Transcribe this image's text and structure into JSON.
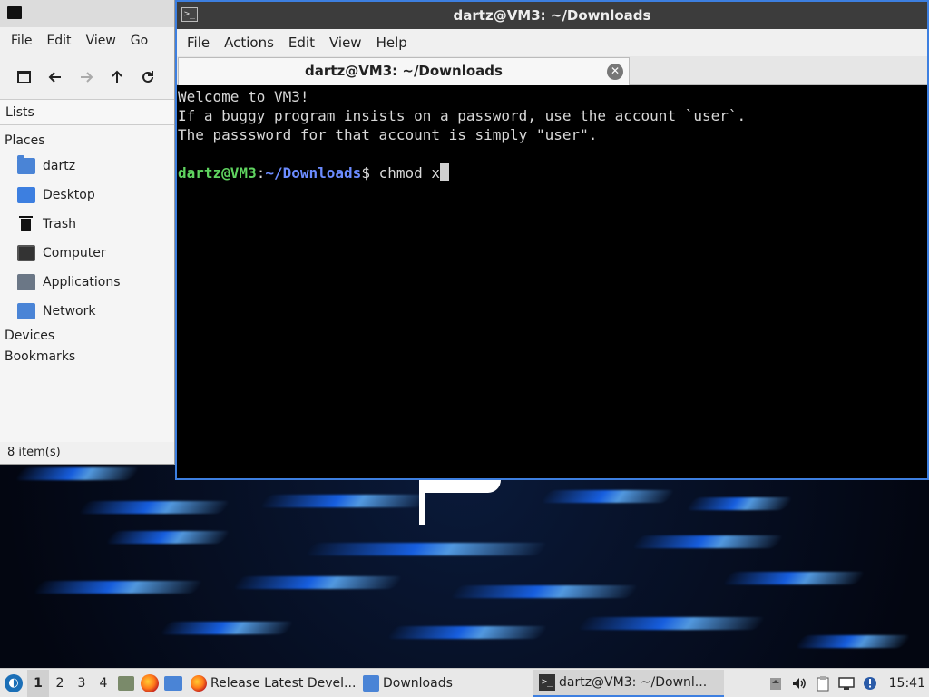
{
  "file_manager": {
    "menu": [
      "File",
      "Edit",
      "View",
      "Go"
    ],
    "toolbar": {
      "new_window_icon": "new-window-icon",
      "back_icon": "arrow-left-icon",
      "forward_icon": "arrow-right-icon",
      "up_icon": "arrow-up-icon",
      "reload_icon": "reload-icon"
    },
    "lists_label": "Lists",
    "places_label": "Places",
    "places": [
      {
        "label": "dartz",
        "icon": "home-folder-icon"
      },
      {
        "label": "Desktop",
        "icon": "desktop-icon"
      },
      {
        "label": "Trash",
        "icon": "trash-icon"
      },
      {
        "label": "Computer",
        "icon": "computer-icon"
      },
      {
        "label": "Applications",
        "icon": "applications-icon"
      },
      {
        "label": "Network",
        "icon": "network-icon"
      }
    ],
    "devices_label": "Devices",
    "bookmarks_label": "Bookmarks",
    "status": "8 item(s)"
  },
  "terminal": {
    "title": "dartz@VM3: ~/Downloads",
    "menu": [
      "File",
      "Actions",
      "Edit",
      "View",
      "Help"
    ],
    "tab_label": "dartz@VM3: ~/Downloads",
    "lines": [
      "Welcome to VM3!",
      "If a buggy program insists on a password, use the account `user`.",
      "The passsword for that account is simply \"user\".",
      ""
    ],
    "prompt": {
      "user_host": "dartz@VM3",
      "colon": ":",
      "path": "~/Downloads",
      "symbol": "$ ",
      "command": "chmod x"
    },
    "colors": {
      "prompt_user": "#5fd35f",
      "prompt_path": "#6c8cff",
      "border": "#3d7fe0"
    }
  },
  "taskbar": {
    "workspaces": [
      "1",
      "2",
      "3",
      "4"
    ],
    "active_workspace": "1",
    "tasks": [
      {
        "label": "Release Latest Devel...",
        "icon": "firefox-icon"
      },
      {
        "label": "Downloads",
        "icon": "folder-icon"
      },
      {
        "label": "dartz@VM3: ~/Downl...",
        "icon": "terminal-icon"
      }
    ],
    "clock": "15:41"
  }
}
